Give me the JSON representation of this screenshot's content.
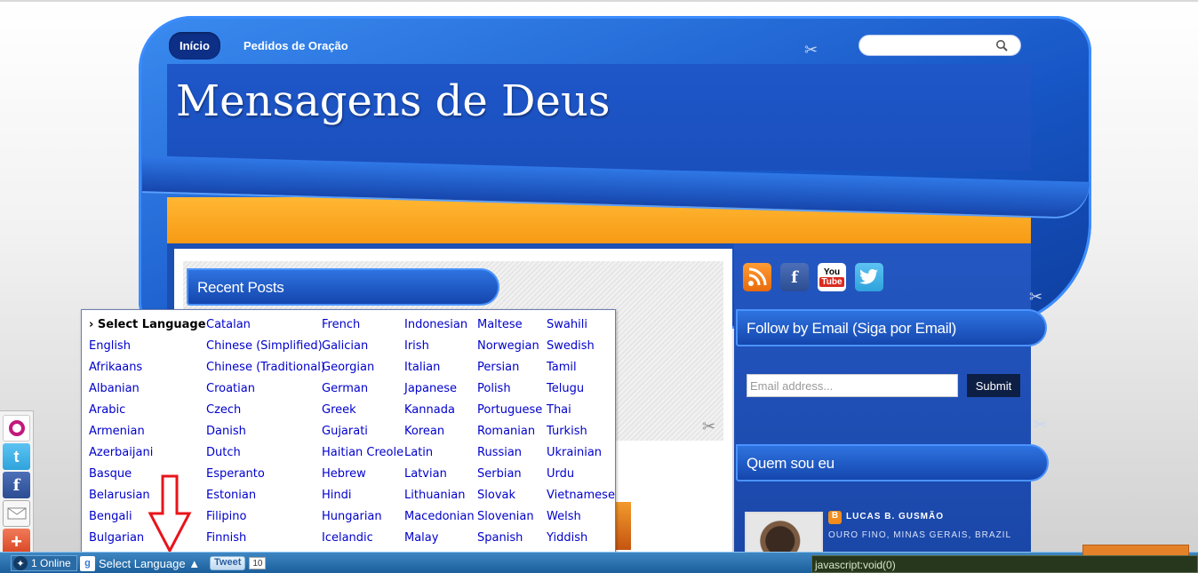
{
  "nav": {
    "items": [
      {
        "label": "Início",
        "active": true
      },
      {
        "label": "Pedidos de Oração",
        "active": false
      }
    ]
  },
  "site": {
    "title": "Mensagens de Deus"
  },
  "widgets": {
    "recent_posts": "Recent Posts",
    "follow_email": "Follow by Email (Siga por Email)",
    "about": "Quem sou eu"
  },
  "email_form": {
    "placeholder": "Email address...",
    "submit_label": "Submit"
  },
  "profile": {
    "name": "LUCAS B. GUSMÃO",
    "location": "OURO FINO, MINAS GERAIS, BRAZIL"
  },
  "social_icons": [
    "rss-icon",
    "facebook-icon",
    "youtube-icon",
    "twitter-icon"
  ],
  "language_menu": {
    "columns": [
      [
        "› Select Language",
        "English",
        "Afrikaans",
        "Albanian",
        "Arabic",
        "Armenian",
        "Azerbaijani",
        "Basque",
        "Belarusian",
        "Bengali",
        "Bulgarian"
      ],
      [
        "Catalan",
        "Chinese (Simplified)",
        "Chinese (Traditional)",
        "Croatian",
        "Czech",
        "Danish",
        "Dutch",
        "Esperanto",
        "Estonian",
        "Filipino",
        "Finnish"
      ],
      [
        "French",
        "Galician",
        "Georgian",
        "German",
        "Greek",
        "Gujarati",
        "Haitian Creole",
        "Hebrew",
        "Hindi",
        "Hungarian",
        "Icelandic"
      ],
      [
        "Indonesian",
        "Irish",
        "Italian",
        "Japanese",
        "Kannada",
        "Korean",
        "Latin",
        "Latvian",
        "Lithuanian",
        "Macedonian",
        "Malay"
      ],
      [
        "Maltese",
        "Norwegian",
        "Persian",
        "Polish",
        "Portuguese",
        "Romanian",
        "Russian",
        "Serbian",
        "Slovak",
        "Slovenian",
        "Spanish"
      ],
      [
        "Swahili",
        "Swedish",
        "Tamil",
        "Telugu",
        "Thai",
        "Turkish",
        "Ukrainian",
        "Urdu",
        "Vietnamese",
        "Welsh",
        "Yiddish"
      ]
    ]
  },
  "bottom_bar": {
    "online": "1 Online",
    "select_language": "Select Language ▲",
    "tweet": "Tweet",
    "tweet_count": "10"
  },
  "status_bar": {
    "url": "javascript:void(0)"
  },
  "colors": {
    "header_blue": "#1a4fbd",
    "orange_band": "#f79a15",
    "link_blue": "#0000cc",
    "bottom_bar": "#1b5f9c"
  }
}
